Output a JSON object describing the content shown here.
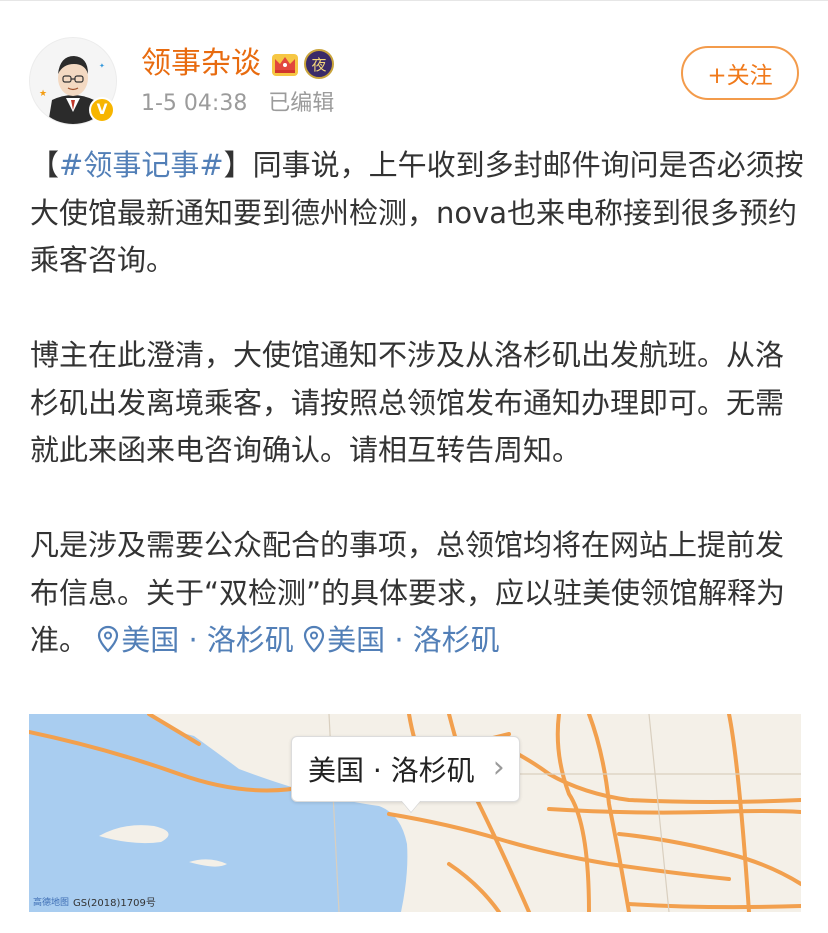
{
  "post": {
    "username": "领事杂谈",
    "night_badge_text": "夜",
    "verified_badge_text": "V",
    "meta": "1-5 04:38   已编辑",
    "follow_button_label": "+关注",
    "body": {
      "p1_bracket_open": "【",
      "p1_hashtag": "#领事记事#",
      "p1_bracket_close": "】",
      "p1_text": "同事说，上午收到多封邮件询问是否必须按大使馆最新通知要到德州检测，nova也来电称接到很多预约乘客咨询。",
      "p2_text": "博主在此澄清，大使馆通知不涉及从洛杉矶出发航班。从洛杉矶出发离境乘客，请按照总领馆发布通知办理即可。无需就此来函来电咨询确认。请相互转告周知。",
      "p3_text": "凡是涉及需要公众配合的事项，总领馆均将在网站上提前发布信息。关于“双检测”的具体要求，应以驻美使领馆解释为准。",
      "location_1": "美国 · 洛杉矶",
      "location_2": "美国 · 洛杉矶"
    },
    "map": {
      "bubble_label": "美国 · 洛杉矶",
      "provider": "高德地图",
      "credit": "GS(2018)1709号"
    }
  },
  "colors": {
    "username": "#e86b0f",
    "link": "#527fb7",
    "follow": "#f0791a",
    "sea": "#a9cdf0",
    "land": "#f4f0e8",
    "road": "#f2a04e"
  },
  "icons": [
    "avatar",
    "verified-badge",
    "crown-icon",
    "night-badge",
    "pin-icon",
    "chevron-right-icon"
  ]
}
